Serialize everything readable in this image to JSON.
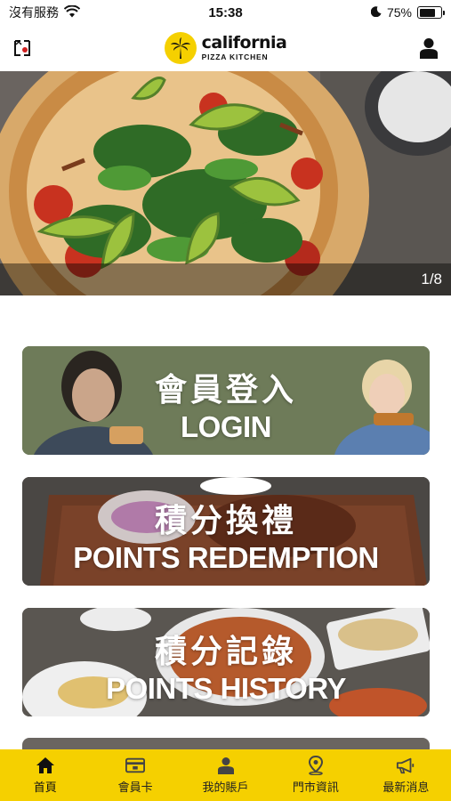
{
  "status_bar": {
    "carrier": "沒有服務",
    "time": "15:38",
    "battery_percent": "75%",
    "battery_level": 0.75,
    "icons": [
      "wifi-icon",
      "moon-icon",
      "battery-icon"
    ]
  },
  "header": {
    "brand_name": "california",
    "brand_sub": "PIZZA KITCHEN",
    "left_icon": "language-switch-icon",
    "right_icon": "user-icon"
  },
  "hero": {
    "counter": "1/8"
  },
  "cards": [
    {
      "title_zh": "會員登入",
      "title_en": "LOGIN"
    },
    {
      "title_zh": "積分換禮",
      "title_en": "POINTS REDEMPTION"
    },
    {
      "title_zh": "積分記錄",
      "title_en": "POINTS HISTORY"
    }
  ],
  "bottom_nav": [
    {
      "label": "首頁",
      "icon": "home-icon",
      "active": true
    },
    {
      "label": "會員卡",
      "icon": "member-card-icon",
      "active": false
    },
    {
      "label": "我的賬戶",
      "icon": "account-icon",
      "active": false
    },
    {
      "label": "門市資訊",
      "icon": "location-pin-icon",
      "active": false
    },
    {
      "label": "最新消息",
      "icon": "megaphone-icon",
      "active": false
    }
  ],
  "colors": {
    "brand_yellow": "#f5d000",
    "nav_text": "#222222"
  }
}
